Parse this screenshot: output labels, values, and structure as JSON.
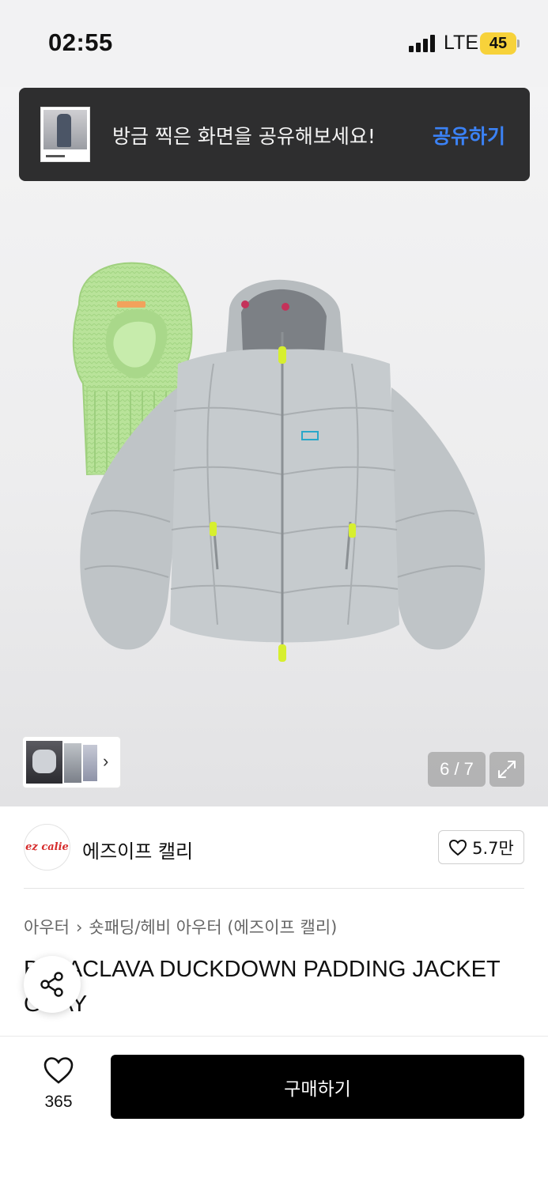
{
  "status_bar": {
    "time": "02:55",
    "network": "LTE",
    "battery": "45"
  },
  "toast": {
    "message": "방금 찍은 화면을 공유해보세요!",
    "action": "공유하기"
  },
  "gallery": {
    "counter": "6 / 7"
  },
  "brand": {
    "logo_text": "ez calie",
    "name": "에즈이프 캘리",
    "likes": "5.7만"
  },
  "breadcrumb": {
    "category": "아우터",
    "subcategory": "숏패딩/헤비 아우터 (에즈이프 캘리)"
  },
  "product": {
    "title": "BALACLAVA DUCKDOWN PADDING JACKET GRAY"
  },
  "bottom_bar": {
    "wish_count": "365",
    "buy_label": "구매하기"
  },
  "colors": {
    "accent_blue": "#3b82f6",
    "toast_bg": "#2e2e2f",
    "battery": "#f7d23a",
    "buy_button": "#000000"
  }
}
